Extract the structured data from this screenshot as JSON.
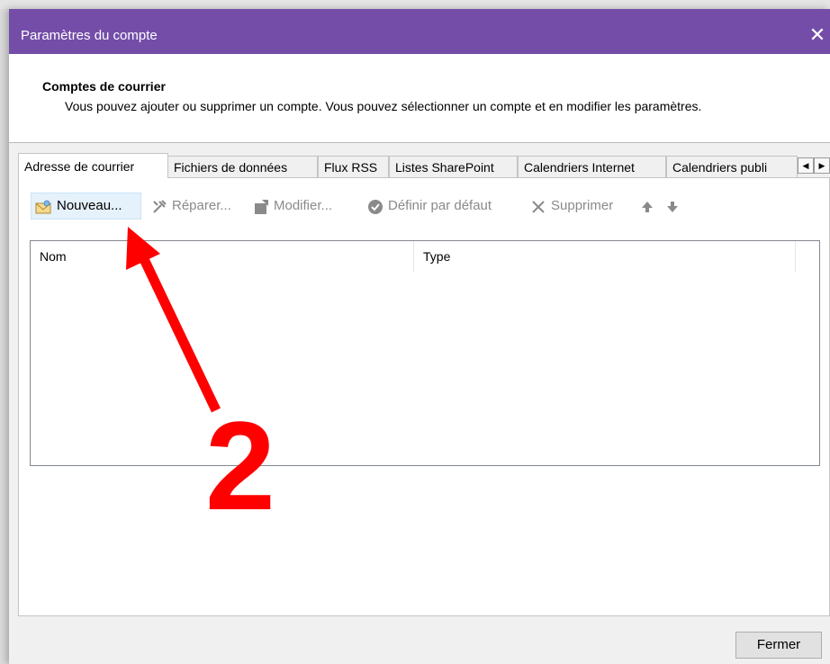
{
  "window": {
    "title": "Paramètres du compte",
    "close_glyph": "✕"
  },
  "header": {
    "title": "Comptes de courrier",
    "description": "Vous pouvez ajouter ou supprimer un compte. Vous pouvez sélectionner un compte et en modifier les paramètres."
  },
  "tabs": [
    {
      "label": "Adresse de courrier",
      "active": true
    },
    {
      "label": "Fichiers de données"
    },
    {
      "label": "Flux RSS"
    },
    {
      "label": "Listes SharePoint"
    },
    {
      "label": "Calendriers Internet"
    },
    {
      "label": "Calendriers publi"
    }
  ],
  "tab_scroll": {
    "left_glyph": "◀",
    "right_glyph": "▶"
  },
  "toolbar": {
    "new_label": "Nouveau...",
    "repair_label": "Réparer...",
    "modify_label": "Modifier...",
    "default_label": "Définir par défaut",
    "delete_label": "Supprimer",
    "icons": [
      "new-mail-icon",
      "repair-tools-icon",
      "modify-icon",
      "check-circle-icon",
      "x-icon",
      "arrow-up-icon",
      "arrow-down-icon"
    ]
  },
  "list": {
    "columns": [
      "Nom",
      "Type"
    ],
    "rows": []
  },
  "footer": {
    "close_label": "Fermer"
  },
  "annotation": {
    "step_number": "2",
    "color": "#ff0000"
  },
  "colors": {
    "titlebar": "#744da9",
    "highlight": "#e5f1fb"
  }
}
